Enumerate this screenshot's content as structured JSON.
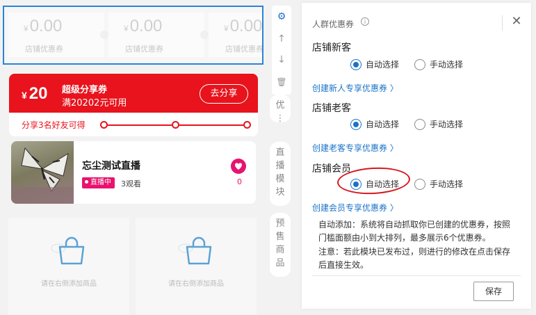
{
  "preview": {
    "coupons": [
      {
        "currency": "¥",
        "amount": "0.00",
        "label": "店铺优惠券"
      },
      {
        "currency": "¥",
        "amount": "0.00",
        "label": "店铺优惠券"
      },
      {
        "currency": "¥",
        "amount": "0.00",
        "label": "店铺优惠券"
      }
    ],
    "share_coupon": {
      "currency": "¥",
      "amount": "20",
      "title": "超级分享券",
      "condition": "满20202元可用",
      "button": "去分享",
      "progress_text": "分享3名好友可得",
      "color": "#e8131c"
    },
    "live": {
      "title": "忘尘测试直播",
      "badge": "直播中",
      "viewers": "3观看",
      "likes": "0",
      "thumb_icon": "butterfly-photo"
    },
    "goods": [
      {
        "hint": "请在右侧添加商品",
        "icon": "shopping-bag-icon"
      },
      {
        "hint": "请在右侧添加商品",
        "icon": "shopping-bag-icon"
      }
    ]
  },
  "toolbar": {
    "tools": [
      {
        "name": "settings-gear-icon",
        "glyph": "⚙"
      },
      {
        "name": "move-up-icon",
        "glyph": "↑"
      },
      {
        "name": "move-down-icon",
        "glyph": "↓"
      },
      {
        "name": "delete-trash-icon",
        "glyph": "🗑"
      }
    ],
    "tabs": [
      {
        "label": "优\n⋮"
      },
      {
        "label": "直\n播\n模\n块"
      },
      {
        "label": "预\n售\n商\n品"
      }
    ]
  },
  "panel": {
    "title": "人群优惠券",
    "info_icon": "i",
    "close": "✕",
    "groups": [
      {
        "title": "店铺新客",
        "auto": "自动选择",
        "manual": "手动选择",
        "selected": "auto",
        "link": "创建新人专享优惠券 〉"
      },
      {
        "title": "店铺老客",
        "auto": "自动选择",
        "manual": "手动选择",
        "selected": "auto",
        "link": "创建老客专享优惠券 〉"
      },
      {
        "title": "店铺会员",
        "auto": "自动选择",
        "manual": "手动选择",
        "selected": "auto",
        "link": "创建会员专享优惠券 〉"
      }
    ],
    "note_auto": "自动添加：系统将自动抓取你已创建的优惠券，按照门槛面额由小到大排列，最多展示6个优惠券。",
    "note_warning": "注意：若此模块已发布过，则进行的修改在点击保存后直接生效。",
    "save": "保存",
    "accent_color": "#1a73c8"
  }
}
